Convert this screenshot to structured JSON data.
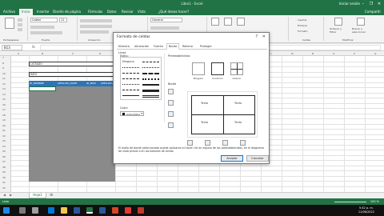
{
  "window": {
    "title": "Libro1 - Excel",
    "user": "Iniciar sesión",
    "minimize": "–",
    "restore": "❐",
    "close": "✕",
    "share": "Compartir"
  },
  "ribbon_tabs": [
    "Archivo",
    "Inicio",
    "Insertar",
    "Diseño de página",
    "Fórmulas",
    "Datos",
    "Revisar",
    "Vista",
    "¿Qué desea hacer?"
  ],
  "ribbon": {
    "groups": [
      "Portapapeles",
      "Fuente",
      "Alineación",
      "Número",
      "Estilos",
      "Celdas",
      "Modificar"
    ],
    "font_name": "Calibri",
    "font_size": "11",
    "number_format": "General",
    "insert": "Insertar",
    "delete": "Eliminar",
    "format": "Formato",
    "sort_filter": "Ordenar y filtrar",
    "find_select": "Buscar y seleccionar"
  },
  "formula_bar": {
    "name_box": "B13",
    "fx": "fx"
  },
  "sheet": {
    "columns": [
      "A",
      "B",
      "C",
      "D",
      "E",
      "F",
      "G",
      "H",
      "I",
      "J",
      "K",
      "L",
      "M",
      "N",
      "O",
      "P",
      "Q"
    ],
    "rows": [
      "7",
      "8",
      "9",
      "10",
      "11",
      "12",
      "13",
      "14",
      "15",
      "16",
      "17",
      "18",
      "19",
      "20",
      "21",
      "22",
      "23",
      "24",
      "25",
      "26",
      "27",
      "28",
      "29",
      "30",
      "31",
      "32"
    ],
    "cells": {
      "b10": "LISTADO",
      "b12": "INFO"
    },
    "header_row": [
      "ID_NOMBRE",
      "APELLIDO_MATE",
      "ID_NUM",
      "APELLIDO_PATE"
    ]
  },
  "sheet_tabs": {
    "active": "Hoja1",
    "add": "⊕"
  },
  "status": {
    "ready": "Listo",
    "zoom": "100 %"
  },
  "taskbar": {
    "time": "5:42 p. m.",
    "date": "11/06/2022"
  },
  "dialog": {
    "title": "Formato de celdas",
    "help": "?",
    "close": "✕",
    "tabs": [
      "Número",
      "Alineación",
      "Fuente",
      "Borde",
      "Relleno",
      "Proteger"
    ],
    "active_tab": "Borde",
    "line_group": "Línea",
    "style_label": "Estilo:",
    "style_none": "Ninguna",
    "color_label": "Color:",
    "color_value": "Automático",
    "presets_label": "Preestablecidos",
    "presets": [
      "Ninguno",
      "Contorno",
      "Interior"
    ],
    "border_label": "Borde",
    "preview_text": "Texto",
    "description": "El estilo de borde seleccionado puede aplicarse al hacer clic en alguno de los preestablecidos, en el diagrama de vista previa o en los botones de arriba.",
    "ok": "Aceptar",
    "cancel": "Cancelar"
  }
}
